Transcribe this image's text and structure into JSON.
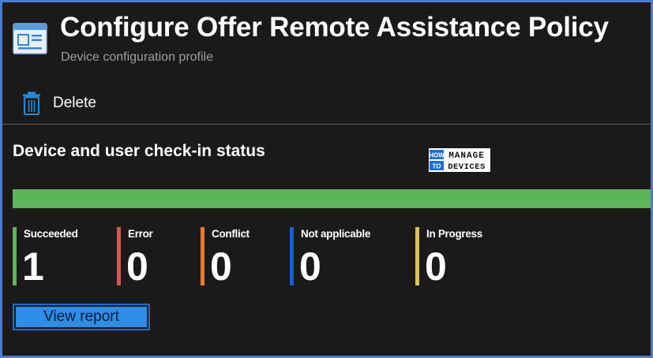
{
  "header": {
    "title": "Configure Offer Remote Assistance Policy",
    "subtitle": "Device configuration profile",
    "icon": "profile-icon"
  },
  "toolbar": {
    "delete_label": "Delete",
    "delete_icon": "trash-icon"
  },
  "section": {
    "title": "Device and user check-in status",
    "progress_fraction": 1.0,
    "progress_color": "#5db459"
  },
  "watermark": {
    "line1_left": "HOW",
    "line1_right": "MANAGE",
    "line2_left": "TO",
    "line2_right": "DEVICES"
  },
  "stats": [
    {
      "label": "Succeeded",
      "value": "1",
      "color": "#5db459"
    },
    {
      "label": "Error",
      "value": "0",
      "color": "#d9534f"
    },
    {
      "label": "Conflict",
      "value": "0",
      "color": "#ec7a2a"
    },
    {
      "label": "Not applicable",
      "value": "0",
      "color": "#1660d4"
    },
    {
      "label": "In Progress",
      "value": "0",
      "color": "#dcc35a"
    }
  ],
  "actions": {
    "view_report_label": "View report"
  }
}
